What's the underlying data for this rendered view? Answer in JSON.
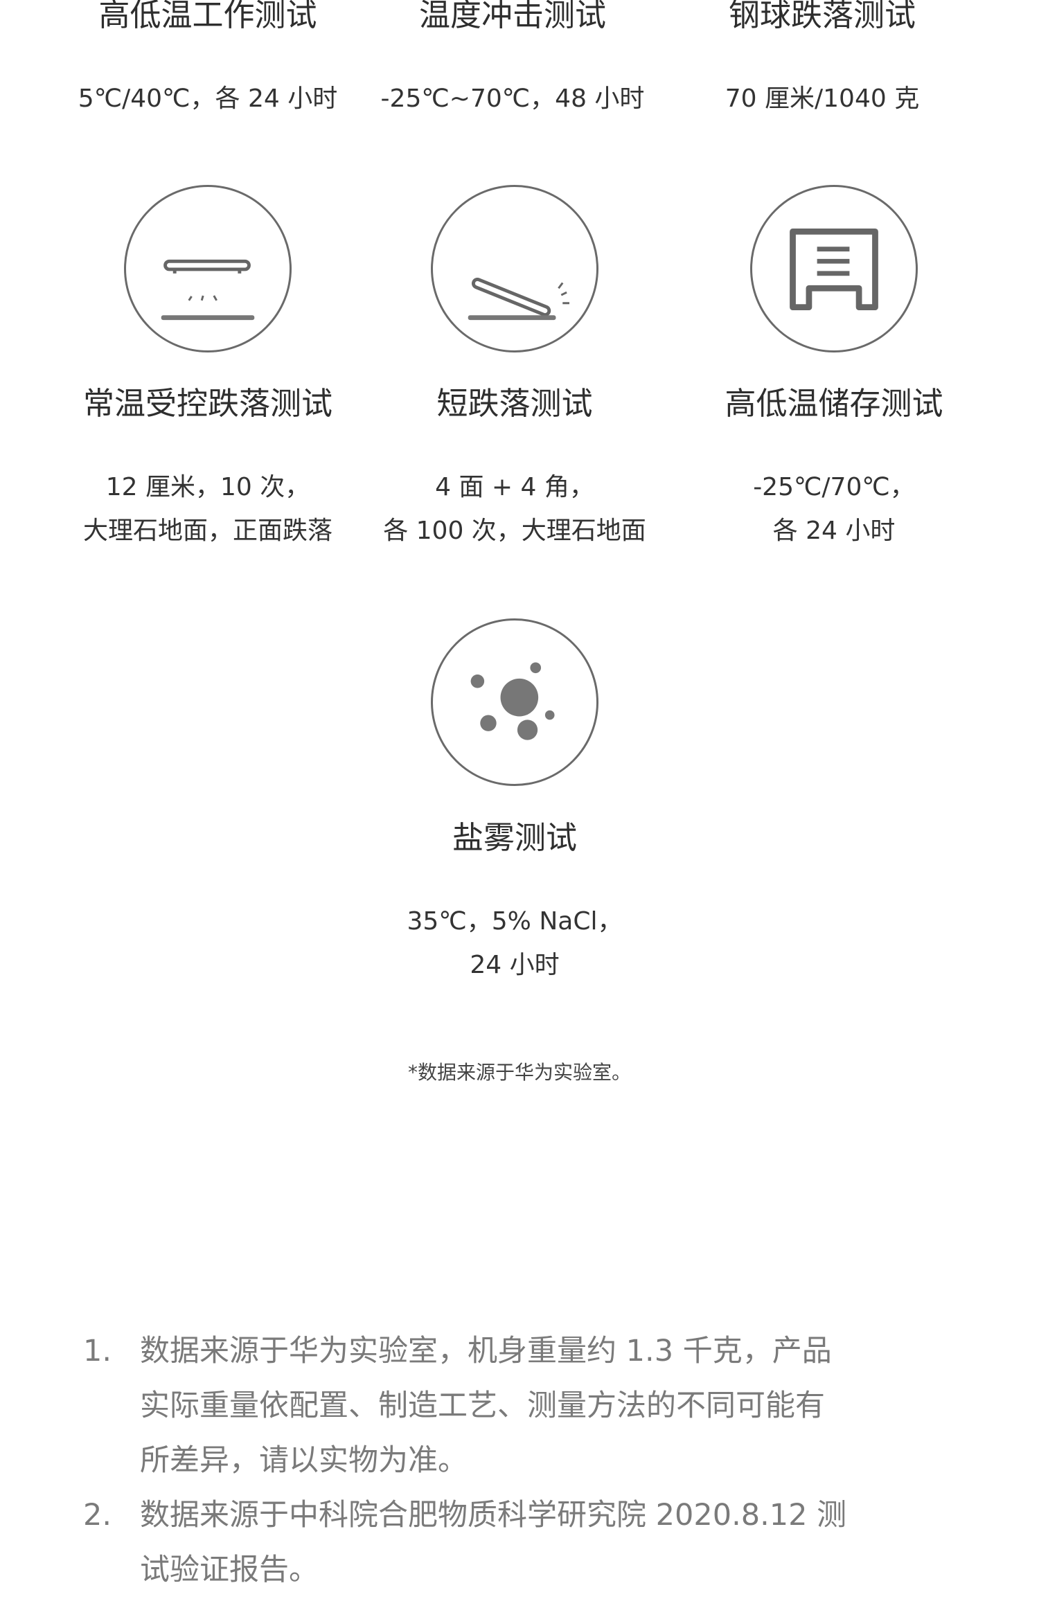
{
  "tests": [
    {
      "title": "高低温工作测试",
      "desc": [
        "5℃/40℃，各 24 小时"
      ]
    },
    {
      "title": "温度冲击测试",
      "desc": [
        "-25℃~70℃，48 小时"
      ]
    },
    {
      "title": "钢球跌落测试",
      "desc": [
        "70 厘米/1040 克"
      ]
    },
    {
      "title": "常温受控跌落测试",
      "icon": "flat-drop-icon",
      "desc": [
        "12 厘米，10 次，",
        "大理石地面，正面跌落"
      ]
    },
    {
      "title": "短跌落测试",
      "icon": "corner-drop-icon",
      "desc": [
        "4 面 + 4 角，",
        "各 100 次，大理石地面"
      ]
    },
    {
      "title": "高低温储存测试",
      "icon": "storage-cabinet-icon",
      "desc": [
        "-25℃/70℃，",
        "各 24 小时"
      ]
    },
    {
      "title": "盐雾测试",
      "icon": "salt-spray-icon",
      "desc": [
        "35℃，5% NaCl，",
        "24 小时"
      ]
    }
  ],
  "footnote": "*数据来源于华为实验室。",
  "notes": [
    {
      "num": "1.",
      "lines": [
        "数据来源于华为实验室，机身重量约 1.3 千克，产品",
        "实际重量依配置、制造工艺、测量方法的不同可能有",
        "所差异，请以实物为准。"
      ]
    },
    {
      "num": "2.",
      "lines": [
        "数据来源于中科院合肥物质科学研究院 2020.8.12 测",
        "试验证报告。"
      ]
    }
  ]
}
